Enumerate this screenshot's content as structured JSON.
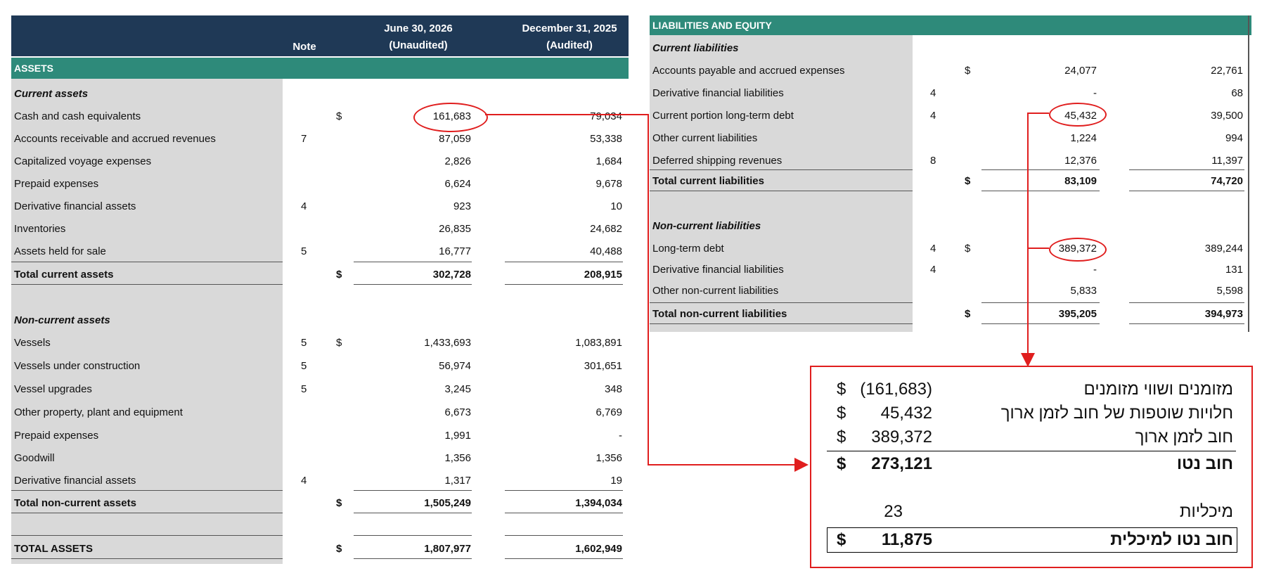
{
  "assets": {
    "header": {
      "note": "Note",
      "col1_line1": "June 30, 2026",
      "col1_line2": "(Unaudited)",
      "col2_line1": "December 31, 2025",
      "col2_line2": "(Audited)"
    },
    "section_title": "ASSETS",
    "current_title": "Current assets",
    "current_rows": [
      {
        "label": "Cash and cash equivalents",
        "note": "",
        "dollar": "$",
        "v1": "161,683",
        "v2": "79,034"
      },
      {
        "label": "Accounts receivable and accrued revenues",
        "note": "7",
        "dollar": "",
        "v1": "87,059",
        "v2": "53,338"
      },
      {
        "label": "Capitalized voyage expenses",
        "note": "",
        "dollar": "",
        "v1": "2,826",
        "v2": "1,684"
      },
      {
        "label": "Prepaid expenses",
        "note": "",
        "dollar": "",
        "v1": "6,624",
        "v2": "9,678"
      },
      {
        "label": "Derivative financial assets",
        "note": "4",
        "dollar": "",
        "v1": "923",
        "v2": "10"
      },
      {
        "label": "Inventories",
        "note": "",
        "dollar": "",
        "v1": "26,835",
        "v2": "24,682"
      },
      {
        "label": "Assets held for sale",
        "note": "5",
        "dollar": "",
        "v1": "16,777",
        "v2": "40,488"
      }
    ],
    "total_current": {
      "label": "Total current assets",
      "dollar": "$",
      "v1": "302,728",
      "v2": "208,915"
    },
    "noncurrent_title": "Non-current assets",
    "noncurrent_rows": [
      {
        "label": "Vessels",
        "note": "5",
        "dollar": "$",
        "v1": "1,433,693",
        "v2": "1,083,891"
      },
      {
        "label": "Vessels under construction",
        "note": "5",
        "dollar": "",
        "v1": "56,974",
        "v2": "301,651"
      },
      {
        "label": "Vessel upgrades",
        "note": "5",
        "dollar": "",
        "v1": "3,245",
        "v2": "348"
      },
      {
        "label": "Other property, plant and equipment",
        "note": "",
        "dollar": "",
        "v1": "6,673",
        "v2": "6,769"
      },
      {
        "label": "Prepaid expenses",
        "note": "",
        "dollar": "",
        "v1": "1,991",
        "v2": "-"
      },
      {
        "label": "Goodwill",
        "note": "",
        "dollar": "",
        "v1": "1,356",
        "v2": "1,356"
      },
      {
        "label": "Derivative financial assets",
        "note": "4",
        "dollar": "",
        "v1": "1,317",
        "v2": "19"
      }
    ],
    "total_noncurrent": {
      "label": "Total non-current assets",
      "dollar": "$",
      "v1": "1,505,249",
      "v2": "1,394,034"
    },
    "total_assets": {
      "label": "TOTAL ASSETS",
      "dollar": "$",
      "v1": "1,807,977",
      "v2": "1,602,949"
    }
  },
  "liabilities": {
    "section_title": "LIABILITIES AND EQUITY",
    "current_title": "Current liabilities",
    "current_rows": [
      {
        "label": "Accounts payable and accrued expenses",
        "note": "",
        "dollar": "$",
        "v1": "24,077",
        "v2": "22,761"
      },
      {
        "label": "Derivative financial liabilities",
        "note": "4",
        "dollar": "",
        "v1": "-",
        "v2": "68"
      },
      {
        "label": "Current portion long-term debt",
        "note": "4",
        "dollar": "",
        "v1": "45,432",
        "v2": "39,500"
      },
      {
        "label": "Other current liabilities",
        "note": "",
        "dollar": "",
        "v1": "1,224",
        "v2": "994"
      },
      {
        "label": "Deferred shipping revenues",
        "note": "8",
        "dollar": "",
        "v1": "12,376",
        "v2": "11,397"
      }
    ],
    "total_current": {
      "label": "Total current liabilities",
      "dollar": "$",
      "v1": "83,109",
      "v2": "74,720"
    },
    "noncurrent_title": "Non-current liabilities",
    "noncurrent_rows": [
      {
        "label": "Long-term debt",
        "note": "4",
        "dollar": "$",
        "v1": "389,372",
        "v2": "389,244"
      },
      {
        "label": "Derivative financial liabilities",
        "note": "4",
        "dollar": "",
        "v1": "-",
        "v2": "131"
      },
      {
        "label": "Other non-current liabilities",
        "note": "",
        "dollar": "",
        "v1": "5,833",
        "v2": "5,598"
      }
    ],
    "total_noncurrent": {
      "label": "Total non-current liabilities",
      "dollar": "$",
      "v1": "395,205",
      "v2": "394,973"
    }
  },
  "net_debt_box": {
    "rows": [
      {
        "label": "מזומנים ושווי מזומנים",
        "dollar": "$",
        "value": "(161,683)"
      },
      {
        "label": "חלויות שוטפות של חוב לזמן ארוך",
        "dollar": "$",
        "value": "45,432"
      },
      {
        "label": "חוב לזמן ארוך",
        "dollar": "$",
        "value": "389,372"
      }
    ],
    "net_debt": {
      "label": "חוב נטו",
      "dollar": "$",
      "value": "273,121"
    },
    "tankers": {
      "label": "מיכליות",
      "value": "23"
    },
    "net_debt_per_tanker": {
      "label": "חוב נטו למיכלית",
      "dollar": "$",
      "value": "11,875"
    }
  },
  "colors": {
    "navy": "#1f3956",
    "teal": "#2e8a7a",
    "gray": "#d9d9d9",
    "red": "#e01e1e"
  }
}
